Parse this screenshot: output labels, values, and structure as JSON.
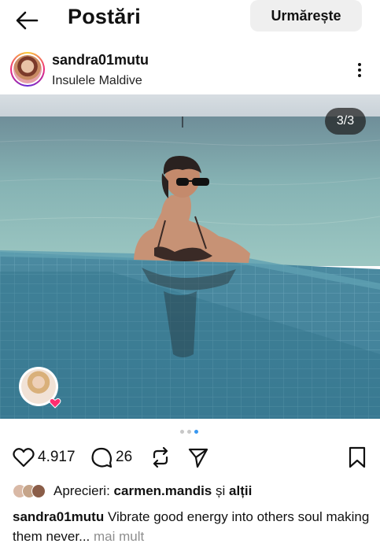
{
  "header": {
    "title": "Postări",
    "follow_label": "Urmărește"
  },
  "post": {
    "username": "sandra01mutu",
    "location": "Insulele Maldive",
    "image_counter": "3/3",
    "carousel": {
      "count": 3,
      "active": 3
    }
  },
  "actions": {
    "likes_count": "4.917",
    "comments_count": "26"
  },
  "likes_line": {
    "label": "Aprecieri:",
    "user": "carmen.mandis",
    "connector": "și",
    "others": "alții"
  },
  "caption": {
    "username": "sandra01mutu",
    "text": "Vibrate good energy into others soul making them never",
    "ellipsis": "...",
    "more": "mai mult"
  },
  "colors": {
    "accent": "#3897f0",
    "follow_bg": "#efefef",
    "muted": "#8e8e8e"
  }
}
